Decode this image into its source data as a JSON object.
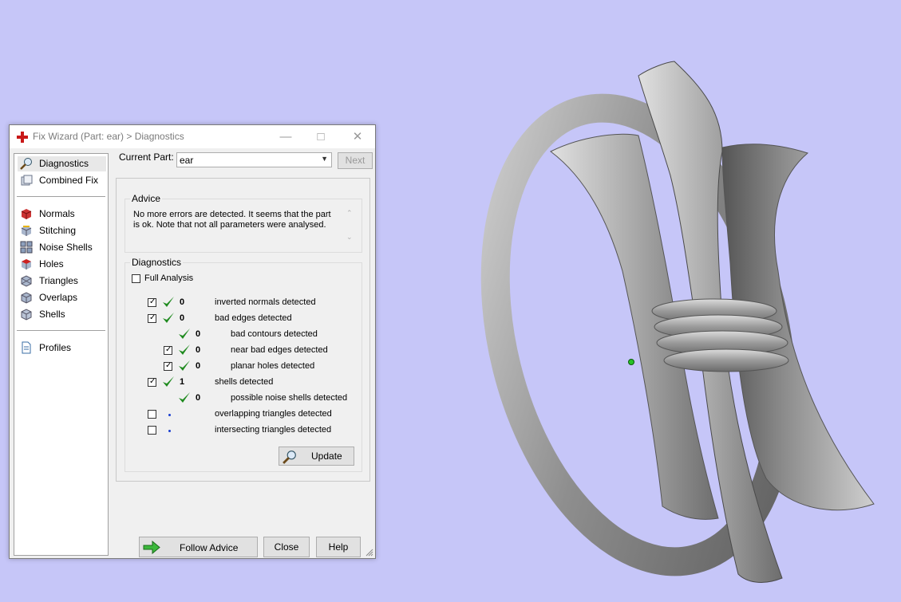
{
  "window": {
    "title": "Fix Wizard (Part: ear) > Diagnostics"
  },
  "nav": {
    "items": [
      {
        "label": "Diagnostics",
        "icon": "magnifier-icon"
      },
      {
        "label": "Combined Fix",
        "icon": "combined-fix-icon"
      },
      {
        "label": "Normals",
        "icon": "normals-cube-icon"
      },
      {
        "label": "Stitching",
        "icon": "stitching-cube-icon"
      },
      {
        "label": "Noise Shells",
        "icon": "noise-shells-cube-icon"
      },
      {
        "label": "Holes",
        "icon": "holes-cube-icon"
      },
      {
        "label": "Triangles",
        "icon": "triangles-cube-icon"
      },
      {
        "label": "Overlaps",
        "icon": "overlaps-cube-icon"
      },
      {
        "label": "Shells",
        "icon": "shells-cube-icon"
      },
      {
        "label": "Profiles",
        "icon": "profiles-document-icon"
      }
    ],
    "selected": "Diagnostics"
  },
  "current_part": {
    "label": "Current Part:",
    "value": "ear",
    "next_label": "Next"
  },
  "advice": {
    "title": "Advice",
    "text": "No more errors are detected. It seems that the part is ok. Note that not all parameters were analysed."
  },
  "diagnostics": {
    "title": "Diagnostics",
    "full_analysis_label": "Full Analysis",
    "full_analysis_checked": false,
    "rows": [
      {
        "checked": true,
        "status": "ok",
        "count": "0",
        "label": "inverted normals detected"
      },
      {
        "checked": true,
        "status": "ok",
        "count": "0",
        "label": "bad edges detected"
      },
      {
        "checked": null,
        "status": "ok",
        "count": "0",
        "label": "bad contours detected"
      },
      {
        "checked": true,
        "status": "ok",
        "count": "0",
        "label": "near bad edges detected"
      },
      {
        "checked": true,
        "status": "ok",
        "count": "0",
        "label": "planar holes detected"
      },
      {
        "checked": true,
        "status": "ok",
        "count": "1",
        "label": "shells detected"
      },
      {
        "checked": null,
        "status": "ok",
        "count": "0",
        "label": "possible noise shells detected"
      },
      {
        "checked": false,
        "status": "not-analysed",
        "count": "",
        "label": "overlapping triangles detected"
      },
      {
        "checked": false,
        "status": "not-analysed",
        "count": "",
        "label": "intersecting triangles detected"
      }
    ],
    "update_label": "Update"
  },
  "footer": {
    "follow_advice_label": "Follow Advice",
    "close_label": "Close",
    "help_label": "Help"
  },
  "colors": {
    "viewport_background": "#c6c6f8",
    "check_green": "#1f8a1f",
    "model_gray": "#9a9a9a"
  }
}
